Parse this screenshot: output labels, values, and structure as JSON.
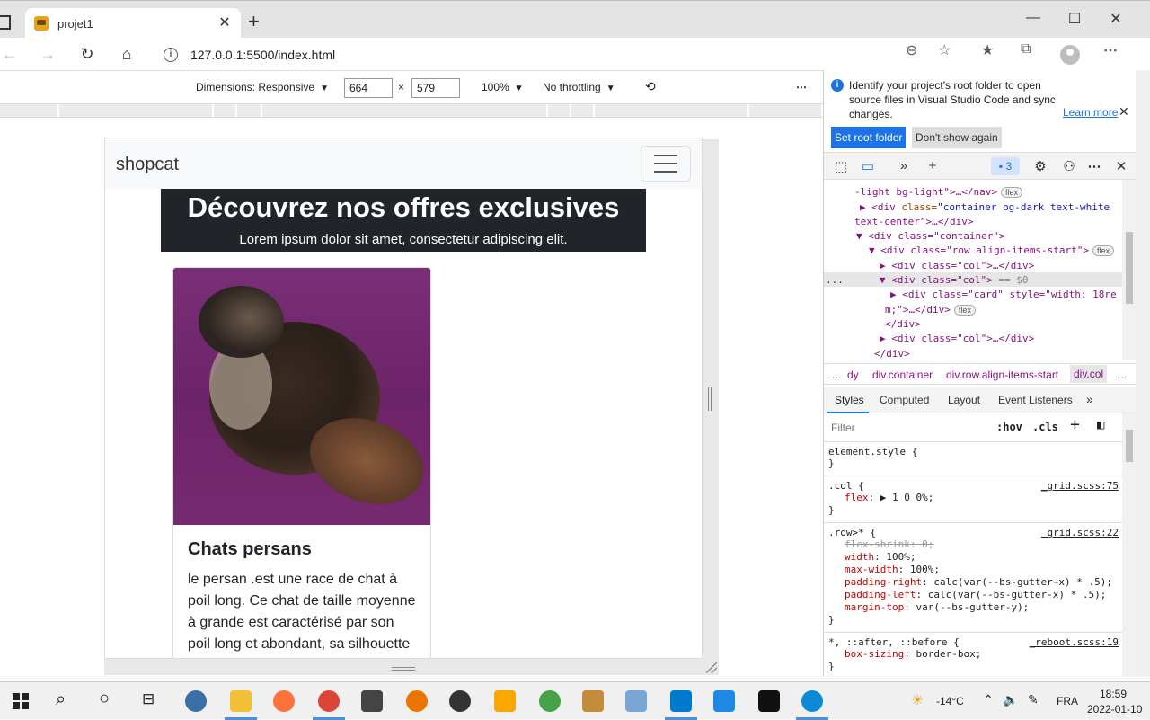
{
  "browser": {
    "tab_title": "projet1",
    "url": "127.0.0.1:5500/index.html"
  },
  "device_toolbar": {
    "dimensions_label": "Dimensions: Responsive",
    "width": "664",
    "height": "579",
    "zoom": "100%",
    "throttling": "No throttling"
  },
  "site": {
    "brand": "shopcat",
    "hero_title": "Découvrez nos offres exclusives",
    "hero_subtitle": "Lorem ipsum dolor sit amet, consectetur adipiscing elit.",
    "card_title": "Chats persans",
    "card_text": "le persan .est une race de chat à poil long. Ce chat de taille moyenne à grande est caractérisé par son poil long et abondant, sa silhouette"
  },
  "devtools": {
    "info_text": "Identify your project's root folder to open source files in Visual Studio Code and sync changes.",
    "learn_more": "Learn more",
    "set_root": "Set root folder",
    "dont_show": "Don't show again",
    "issues_count": "3",
    "dom": {
      "l0": "-light bg-light\">…</nav>",
      "l1_tag": "<div",
      "l1_attr": " class=",
      "l1_val": "\"container bg-dark  text-white",
      "l1b": "text-center\">…</div>",
      "l2": "<div class=\"container\">",
      "l3": "<div class=\"row align-items-start\">",
      "l4": "<div class=\"col\">…</div>",
      "l5": "<div class=\"col\">",
      "l5_eq": " == $0",
      "l6": "<div class=\"card\" style=\"width: 18re",
      "l6b": "m;\">…</div>",
      "l7": "</div>",
      "l8": "<div class=\"col\">…</div>",
      "l9": "</div>",
      "flex": "flex",
      "dots": "..."
    },
    "crumbs": [
      "…",
      "dy",
      "div.container",
      "div.row.align-items-start",
      "div.col",
      "…"
    ],
    "style_tabs": [
      "Styles",
      "Computed",
      "Layout",
      "Event Listeners",
      "»"
    ],
    "filter_placeholder": "Filter",
    "hov": ":hov",
    "cls": ".cls",
    "rules": {
      "r1_sel": "element.style {",
      "close": "}",
      "r2_sel": ".col {",
      "r2_src": "_grid.scss:75",
      "r2_p1_name": "flex",
      "r2_p1_val": ": ▶ 1 0 0%;",
      "r3_sel": ".row>* {",
      "r3_src": "_grid.scss:22",
      "r3_p1": "flex-shrink: 0;",
      "r3_p2_name": "width",
      "r3_p2_val": ": 100%;",
      "r3_p3_name": "max-width",
      "r3_p3_val": ": 100%;",
      "r3_p4_name": "padding-right",
      "r3_p4_val": ": calc(var(--bs-gutter-x) * .5);",
      "r3_p5_name": "padding-left",
      "r3_p5_val": ": calc(var(--bs-gutter-x) * .5);",
      "r3_p6_name": "margin-top",
      "r3_p6_val": ": var(--bs-gutter-y);",
      "r4_sel": "*, ::after, ::before {",
      "r4_src": "_reboot.scss:19",
      "r4_p1_name": "box-sizing",
      "r4_p1_val": ": border-box;"
    }
  },
  "taskbar": {
    "temperature": "-14°C",
    "language": "FRA",
    "time": "18:59",
    "date": "2022-01-10"
  }
}
